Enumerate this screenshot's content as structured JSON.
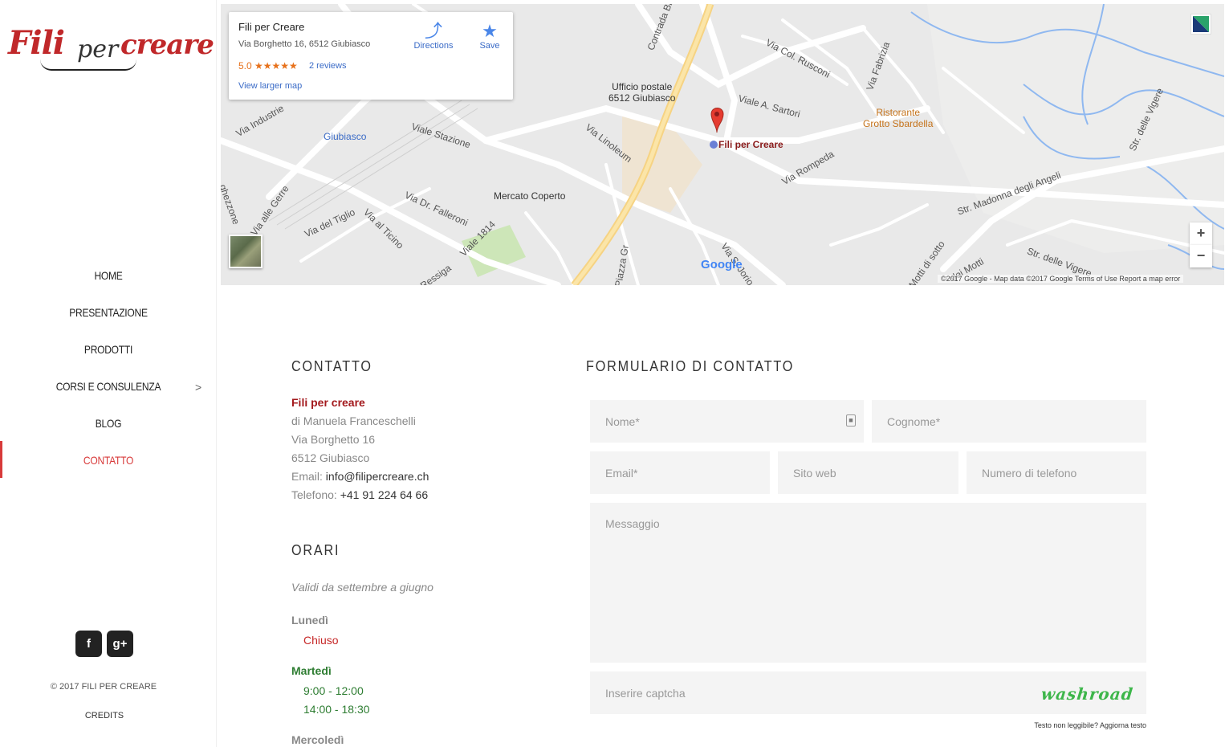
{
  "logo": {
    "part1": "Fili",
    "part2": "per",
    "part3": "creare"
  },
  "nav": {
    "items": [
      {
        "label": "HOME"
      },
      {
        "label": "PRESENTAZIONE"
      },
      {
        "label": "PRODOTTI"
      },
      {
        "label": "CORSI E CONSULENZA",
        "has_submenu": true
      },
      {
        "label": "BLOG"
      },
      {
        "label": "CONTATTO",
        "active": true
      }
    ],
    "chevron": ">"
  },
  "social": {
    "facebook": "f",
    "googleplus": "g+"
  },
  "footer": {
    "copyright": "© 2017 FILI PER CREARE",
    "credits": "CREDITS"
  },
  "map": {
    "card": {
      "name": "Fili per Creare",
      "address": "Via Borghetto 16, 6512 Giubiasco",
      "rating": "5.0 ★★★★★",
      "reviews": "2 reviews",
      "larger_map": "View larger map",
      "directions": "Directions",
      "save": "Save"
    },
    "marker_label": "Fili per Creare",
    "labels": {
      "contrada_bissa": "Contrada Bissa",
      "via_col_rusconi": "Via Col. Rusconi",
      "viale_a_sartori": "Viale A. Sartori",
      "via_fabrizia": "Via Fabrizia",
      "via_industrie": "Via Industrie",
      "viale_stazione": "Viale Stazione",
      "via_linoleum": "Via Linoleum",
      "via_rompeda": "Via Rompeda",
      "via_dr_falleroni": "Via Dr. Falleroni",
      "via_alle_gerre": "Via alle Gerre",
      "via_del_tiglio": "Via del Tiglio",
      "via_al_ticino": "Via al Ticino",
      "viale_1814": "Viale 1814",
      "str_madonna_degli_angeli": "Str. Madonna degli Angeli",
      "str_delle_vigere": "Str. delle Vigere",
      "str_delle_vigere_2": "Str. delle Vigere",
      "motti_di_sotto": "Motti di sotto",
      "dei_motti": "dei Motti",
      "via_s_jorio": "Via S. Jorio",
      "piazza": "Piazza Gr",
      "ghezzone": "ghezzone",
      "ressiga": "Ressiga"
    },
    "pois": {
      "ufficio": "Ufficio postale\n6512 Giubiasco",
      "giubiasco": "Giubiasco",
      "mercato": "Mercato Coperto",
      "ristorante": "Ristorante\nGrotto Sbardella"
    },
    "zoom_in": "+",
    "zoom_out": "−",
    "google": "Google",
    "attribution": "©2017 Google - Map data ©2017 Google     Terms of Use     Report a map error"
  },
  "contatto": {
    "heading": "CONTATTO",
    "company": "Fili per creare",
    "owner": "di Manuela Franceschelli",
    "street": "Via Borghetto 16",
    "city": "6512 Giubiasco",
    "email_label": "Email:",
    "email": "info@filipercreare.ch",
    "phone_label": "Telefono:",
    "phone": "+41 91 224 64 66"
  },
  "orari": {
    "heading": "ORARI",
    "note": "Validi da settembre a giugno",
    "days": [
      {
        "day": "Lunedì",
        "hours": [
          "Chiuso"
        ]
      },
      {
        "day": "Martedì",
        "hours": [
          "9:00 - 12:00",
          "14:00 - 18:30"
        ]
      },
      {
        "day": "Mercoledì",
        "hours": []
      }
    ],
    "colors": {
      "closed": "#c62828",
      "open": "#2e7d32",
      "day_default": "#888888"
    }
  },
  "form": {
    "heading": "FORMULARIO DI CONTATTO",
    "nome": "Nome*",
    "cognome": "Cognome*",
    "email": "Email*",
    "sito": "Sito web",
    "telefono": "Numero di telefono",
    "messaggio": "Messaggio",
    "captcha_placeholder": "Inserire captcha",
    "captcha_text": "washroad",
    "captcha_note": "Testo non leggibile? Aggiorna testo"
  },
  "colors": {
    "accent": "#d83a3a",
    "brand_red": "#a3191d"
  }
}
